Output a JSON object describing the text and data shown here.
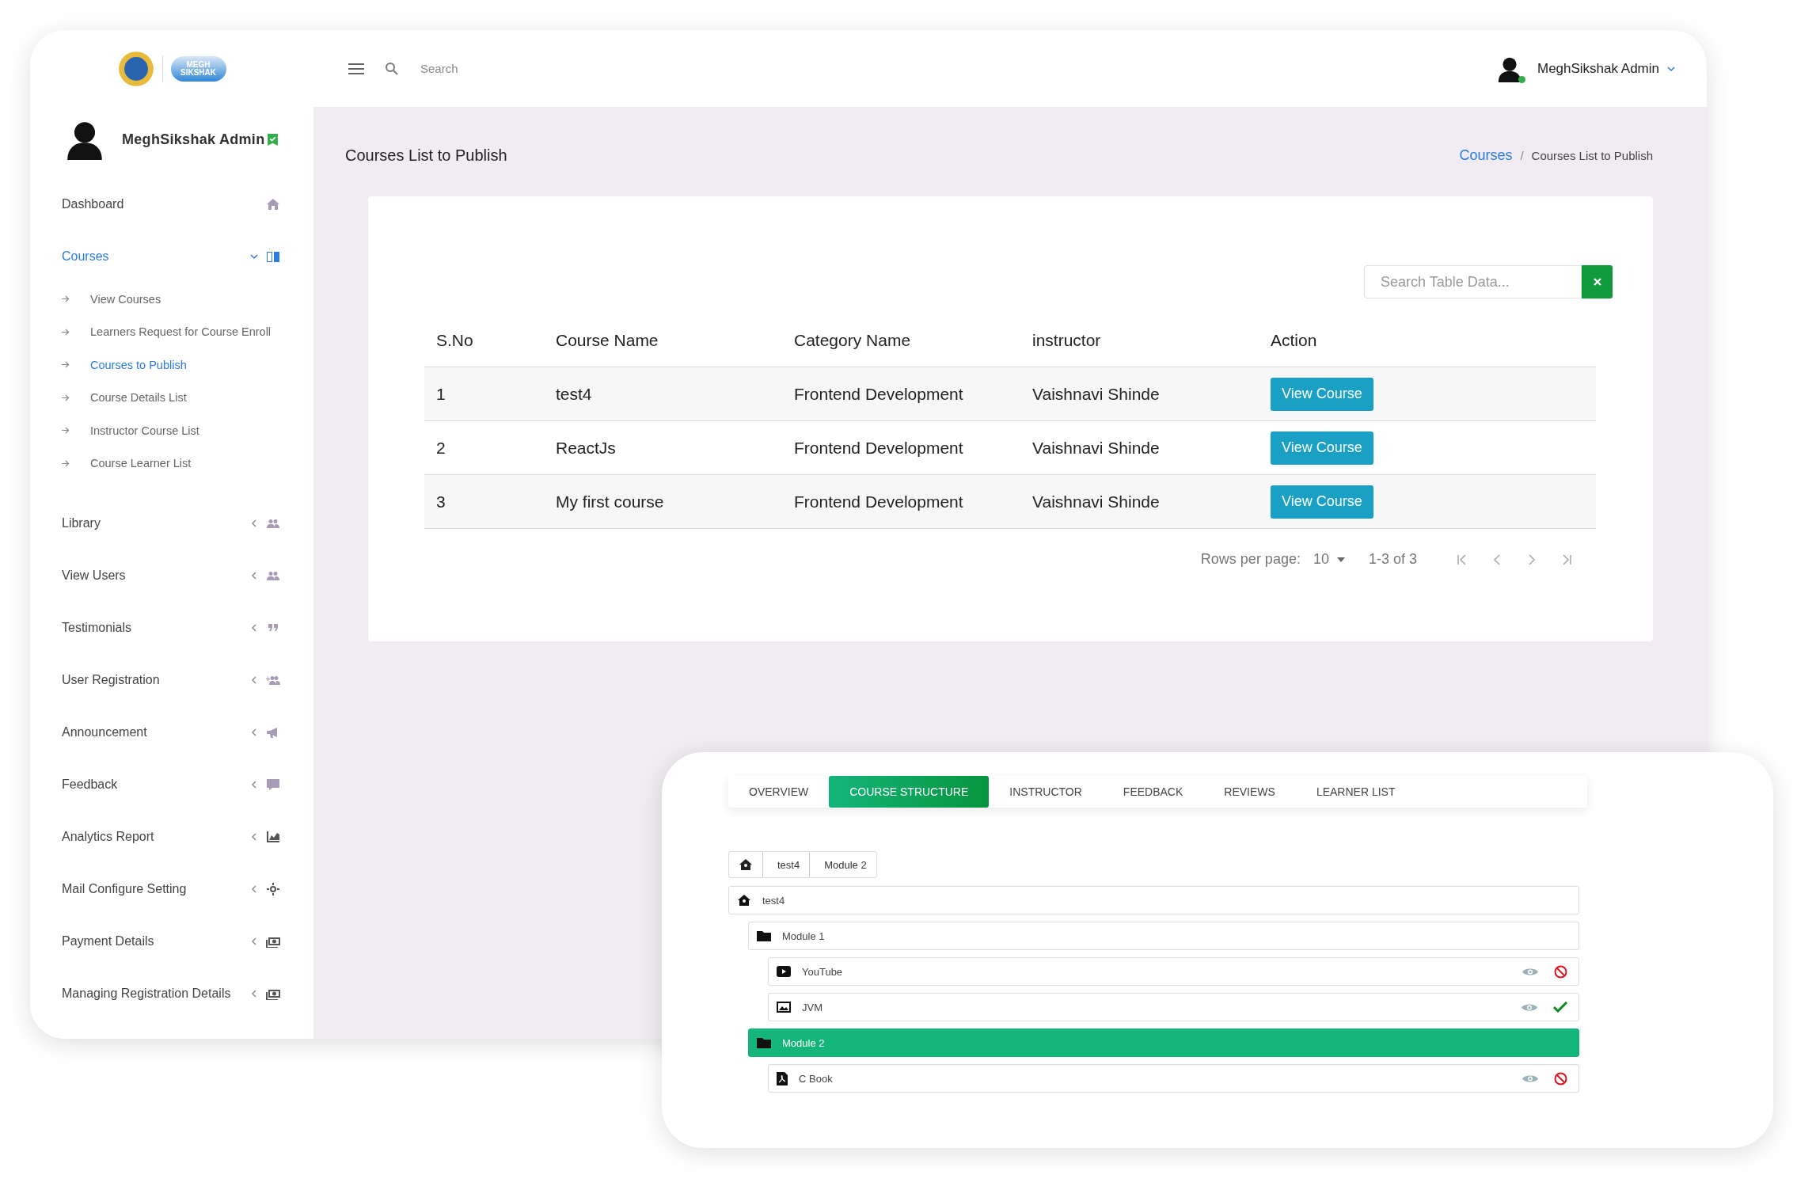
{
  "logo": {
    "lines": [
      "MEGH",
      "SIKSHAK"
    ]
  },
  "profile": {
    "name": "MeghSikshak Admin",
    "verified": true
  },
  "sidebar": {
    "items": [
      {
        "label": "Dashboard",
        "kind": "link",
        "selected": false
      },
      {
        "label": "Courses",
        "kind": "group",
        "selected": true,
        "expanded": true,
        "children": [
          {
            "label": "View Courses",
            "selected": false
          },
          {
            "label": "Learners Request for Course Enroll",
            "selected": false
          },
          {
            "label": "Courses to Publish",
            "selected": true
          },
          {
            "label": "Course Details List",
            "selected": false
          },
          {
            "label": "Instructor Course List",
            "selected": false
          },
          {
            "label": "Course Learner List",
            "selected": false
          }
        ]
      },
      {
        "label": "Library",
        "kind": "group",
        "selected": false,
        "expanded": false
      },
      {
        "label": "View Users",
        "kind": "group",
        "selected": false,
        "expanded": false
      },
      {
        "label": "Testimonials",
        "kind": "group",
        "selected": false,
        "expanded": false
      },
      {
        "label": "User Registration",
        "kind": "group",
        "selected": false,
        "expanded": false
      },
      {
        "label": "Announcement",
        "kind": "group",
        "selected": false,
        "expanded": false
      },
      {
        "label": "Feedback",
        "kind": "group",
        "selected": false,
        "expanded": false
      },
      {
        "label": "Analytics Report",
        "kind": "group",
        "selected": false,
        "expanded": false
      },
      {
        "label": "Mail Configure Setting",
        "kind": "group",
        "selected": false,
        "expanded": false
      },
      {
        "label": "Payment Details",
        "kind": "group",
        "selected": false,
        "expanded": false
      },
      {
        "label": "Managing Registration Details",
        "kind": "group",
        "selected": false,
        "expanded": false
      }
    ]
  },
  "header": {
    "search": {
      "placeholder": "Search"
    },
    "user": {
      "name": "MeghSikshak Admin",
      "online": true
    }
  },
  "page": {
    "title": "Courses List to Publish",
    "breadcrumb_separator": "/",
    "breadcrumb": [
      {
        "label": "Courses",
        "link": true
      },
      {
        "label": "Courses List to Publish",
        "link": false
      }
    ]
  },
  "table": {
    "search": {
      "placeholder": "Search Table Data..."
    },
    "columns": [
      "S.No",
      "Course Name",
      "Category Name",
      "instructor",
      "Action"
    ],
    "rows": [
      {
        "cells": [
          "1",
          "test4",
          "Frontend Development",
          "Vaishnavi Shinde"
        ],
        "action": "View Course"
      },
      {
        "cells": [
          "2",
          "ReactJs",
          "Frontend Development",
          "Vaishnavi Shinde"
        ],
        "action": "View Course"
      },
      {
        "cells": [
          "3",
          "My first course",
          "Frontend Development",
          "Vaishnavi Shinde"
        ],
        "action": "View Course"
      }
    ],
    "pagination": {
      "rows_label": "Rows per page:",
      "rows_value": "10",
      "range": "1-3 of 3"
    }
  },
  "course_panel": {
    "tabs": [
      {
        "label": "OVERVIEW",
        "selected": false
      },
      {
        "label": "COURSE STRUCTURE",
        "selected": true
      },
      {
        "label": "INSTRUCTOR",
        "selected": false
      },
      {
        "label": "FEEDBACK",
        "selected": false
      },
      {
        "label": "REVIEWS",
        "selected": false
      },
      {
        "label": "LEARNER LIST",
        "selected": false
      }
    ],
    "path": [
      "test4",
      "Module 2"
    ],
    "tree": {
      "label": "test4",
      "kind": "course",
      "selected": false,
      "children": [
        {
          "label": "Module 1",
          "kind": "module",
          "selected": false,
          "children": [
            {
              "label": "YouTube",
              "kind": "video",
              "approved": false
            },
            {
              "label": "JVM",
              "kind": "image",
              "approved": true
            }
          ]
        },
        {
          "label": "Module 2",
          "kind": "module",
          "selected": true,
          "children": [
            {
              "label": "C Book",
              "kind": "pdf",
              "approved": false
            }
          ]
        }
      ]
    }
  }
}
